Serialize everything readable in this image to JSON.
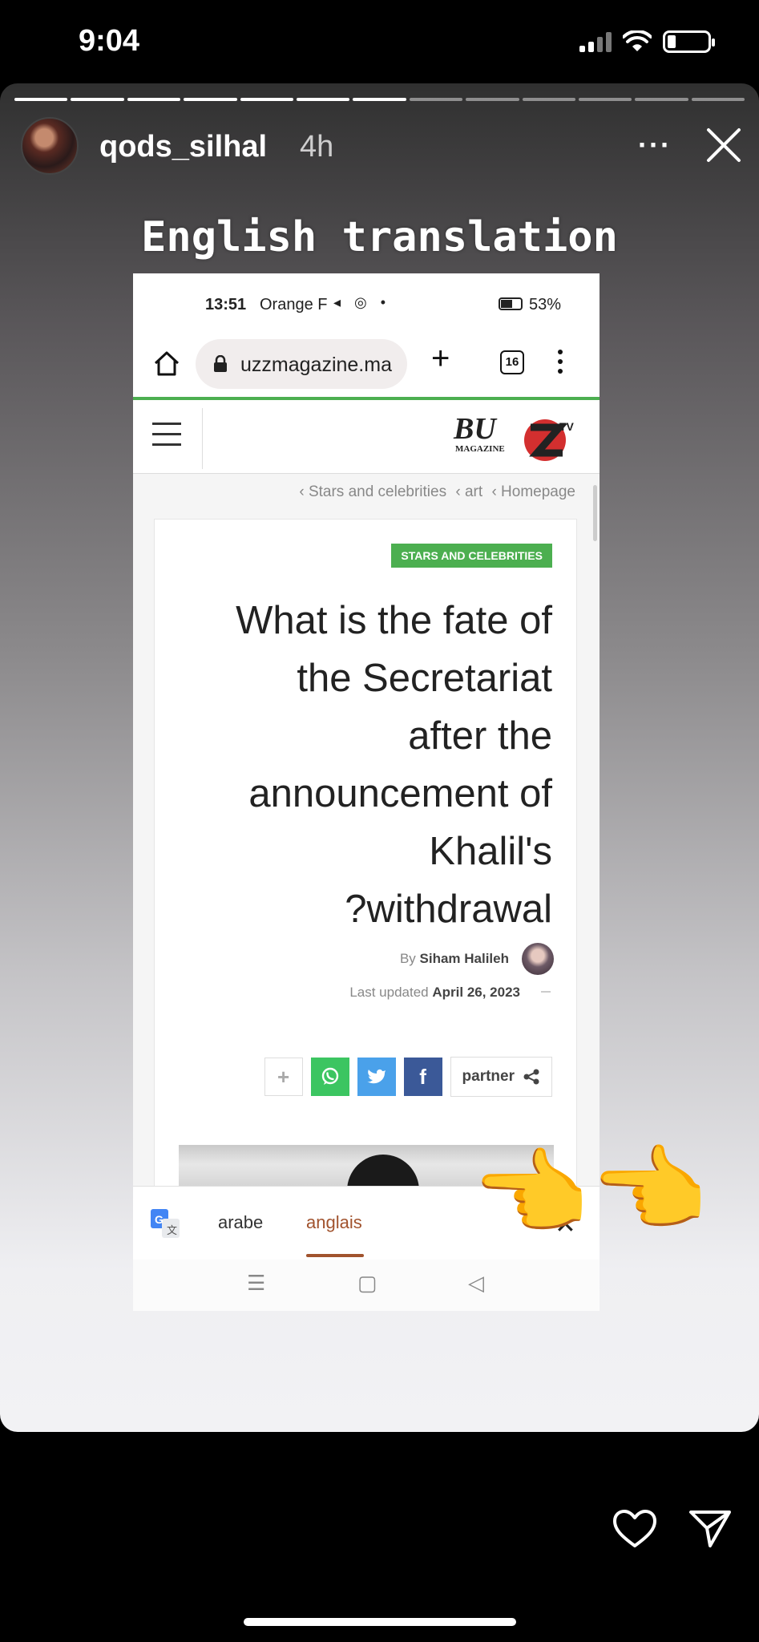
{
  "status_bar": {
    "time": "9:04"
  },
  "story": {
    "username": "qods_silhal",
    "time_ago": "4h",
    "more_label": "···",
    "caption": "English translation"
  },
  "screenshot": {
    "status": {
      "time": "13:51",
      "carrier": "Orange F",
      "icons": "◂ ◎ •",
      "battery_pct": "53%"
    },
    "browser": {
      "url": "uzzmagazine.ma",
      "plus_label": "+",
      "tab_count": "16"
    },
    "site": {
      "logo_text": "BU",
      "logo_sub": "MAGAZINE",
      "logo_tv": "TV",
      "breadcrumb": [
        "‹ Stars and celebrities",
        "‹ art",
        "‹ Homepage"
      ]
    },
    "article": {
      "tag": "STARS AND CELEBRITIES",
      "headline_lines": [
        "What is the fate of",
        "the Secretariat",
        "after the",
        "announcement of",
        "Khalil's",
        "?withdrawal"
      ],
      "by_label": "By",
      "author": "Siham Halileh",
      "updated_label": "Last updated",
      "updated_date": "April 26, 2023",
      "share_plus": "+",
      "share_wa": "✆",
      "share_tw": "🐦",
      "share_fb": "f",
      "partner_label": "partner"
    },
    "translate": {
      "from_lang": "arabe",
      "to_lang": "anglais",
      "close": "✕"
    },
    "nav": {
      "menu": "☰",
      "home": "▢",
      "back": "◁"
    }
  },
  "pointer_emoji": "👉",
  "colors": {
    "accent_green": "#4caf50",
    "translate_accent": "#a1532e"
  }
}
